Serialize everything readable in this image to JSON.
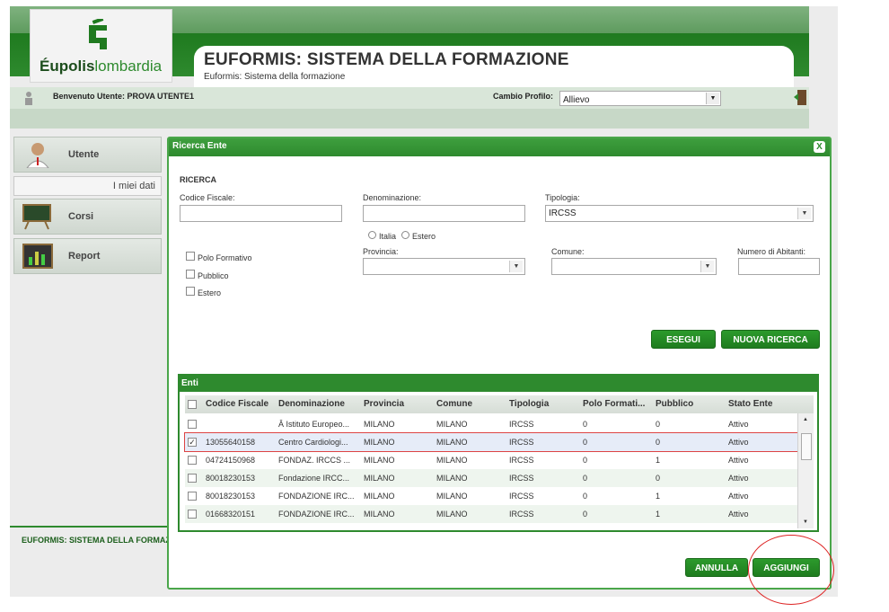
{
  "header": {
    "logo": {
      "bold": "Éupolis",
      "rest": "lombardia"
    },
    "title": "EUFORMIS: SISTEMA DELLA FORMAZIONE",
    "subtitle": "Euformis: Sistema della formazione"
  },
  "userbar": {
    "welcome": "Benvenuto Utente: PROVA UTENTE1",
    "profile_label": "Cambio Profilo:",
    "profile_value": "Allievo"
  },
  "sidebar": {
    "items": [
      {
        "label": "Utente"
      },
      {
        "label": "Corsi"
      },
      {
        "label": "Report"
      }
    ],
    "sub_item": "I miei dati",
    "footer": "EUFORMIS: SISTEMA DELLA FORMAZIONE"
  },
  "modal": {
    "title": "Ricerca Ente",
    "close": "X",
    "section": "RICERCA",
    "fields": {
      "codice_fiscale": {
        "label": "Codice Fiscale:",
        "value": ""
      },
      "denominazione": {
        "label": "Denominazione:",
        "value": ""
      },
      "tipologia": {
        "label": "Tipologia:",
        "value": "IRCSS"
      },
      "provincia": {
        "label": "Provincia:",
        "value": ""
      },
      "comune": {
        "label": "Comune:",
        "value": ""
      },
      "abitanti": {
        "label": "Numero di Abitanti:",
        "value": ""
      }
    },
    "radios": {
      "italia": "Italia",
      "estero": "Estero"
    },
    "checkboxes": [
      {
        "label": "Polo Formativo"
      },
      {
        "label": "Pubblico"
      },
      {
        "label": "Estero"
      }
    ],
    "buttons": {
      "esegui": "ESEGUI",
      "nuova": "NUOVA RICERCA",
      "annulla": "ANNULLA",
      "aggiungi": "AGGIUNGI"
    },
    "grid": {
      "title": "Enti",
      "columns": [
        "Codice Fiscale",
        "Denominazione",
        "Provincia",
        "Comune",
        "Tipologia",
        "Polo Formati...",
        "Pubblico",
        "Stato Ente"
      ],
      "rows": [
        {
          "cf": "",
          "den": "Â Istituto Europeo...",
          "prov": "MILANO",
          "com": "MILANO",
          "tip": "IRCSS",
          "polo": "0",
          "pub": "0",
          "stato": "Attivo",
          "checked": false
        },
        {
          "cf": "13055640158",
          "den": "Centro Cardiologi...",
          "prov": "MILANO",
          "com": "MILANO",
          "tip": "IRCSS",
          "polo": "0",
          "pub": "0",
          "stato": "Attivo",
          "checked": true
        },
        {
          "cf": "04724150968",
          "den": "FONDAZ. IRCCS ...",
          "prov": "MILANO",
          "com": "MILANO",
          "tip": "IRCSS",
          "polo": "0",
          "pub": "1",
          "stato": "Attivo",
          "checked": false
        },
        {
          "cf": "80018230153",
          "den": "Fondazione IRCC...",
          "prov": "MILANO",
          "com": "MILANO",
          "tip": "IRCSS",
          "polo": "0",
          "pub": "0",
          "stato": "Attivo",
          "checked": false
        },
        {
          "cf": "80018230153",
          "den": "FONDAZIONE IRC...",
          "prov": "MILANO",
          "com": "MILANO",
          "tip": "IRCSS",
          "polo": "0",
          "pub": "1",
          "stato": "Attivo",
          "checked": false
        },
        {
          "cf": "01668320151",
          "den": "FONDAZIONE IRC...",
          "prov": "MILANO",
          "com": "MILANO",
          "tip": "IRCSS",
          "polo": "0",
          "pub": "1",
          "stato": "Attivo",
          "checked": false
        }
      ]
    }
  },
  "colors": {
    "brand_green": "#2e8a2e",
    "highlight_red": "#dd2222"
  }
}
